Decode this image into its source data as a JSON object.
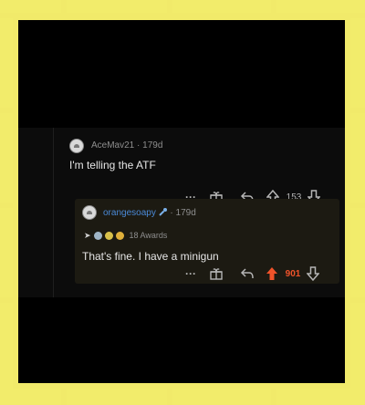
{
  "background": {
    "tile_color": "#f2ec6b",
    "grout_color": "#b7b7b3"
  },
  "comment": {
    "username": "AceMav21",
    "age": "179d",
    "separator": "·",
    "text": "I'm telling the ATF",
    "actions": {
      "more_label": "···",
      "gift_icon": "gift-icon",
      "reply_icon": "reply-arrow-icon",
      "upvote_icon": "upvote-arrow-icon",
      "downvote_icon": "downvote-arrow-icon",
      "score": "153"
    }
  },
  "reply": {
    "username": "orangesoapy",
    "age": "179d",
    "separator": "·",
    "flair_icon": "wrench-flair-icon",
    "awards_label": "18 Awards",
    "text": "That's fine. I have a minigun",
    "actions": {
      "more_label": "···",
      "score": "901",
      "upvoted": true,
      "upvote_color": "#f0532a"
    }
  }
}
